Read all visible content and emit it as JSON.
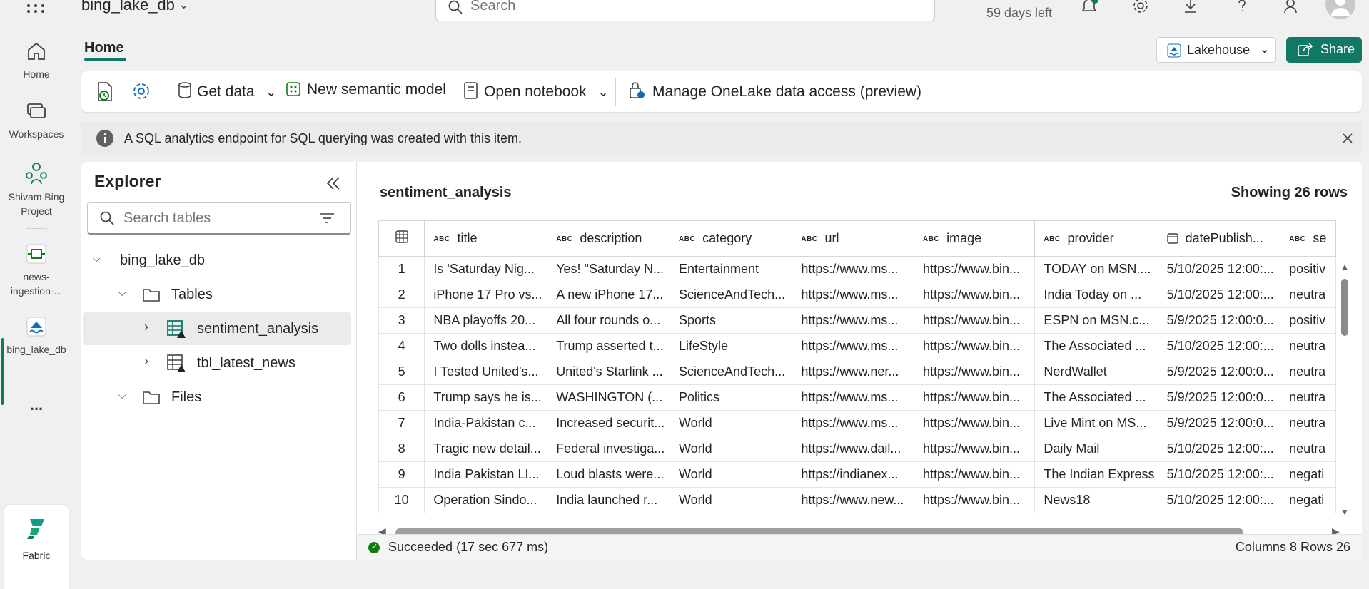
{
  "topbar": {
    "workspace_name": "bing_lake_db",
    "search_placeholder": "Search",
    "trial_text": "59 days left"
  },
  "rail": {
    "items": [
      {
        "label": "Home",
        "icon": "home-icon"
      },
      {
        "label": "Workspaces",
        "icon": "workspaces-icon"
      },
      {
        "label": "Shivam Bing Project",
        "icon": "workspace-people-icon"
      },
      {
        "label": "news-ingestion-...",
        "icon": "pipeline-icon"
      },
      {
        "label": "bing_lake_db",
        "icon": "lakehouse-icon"
      }
    ],
    "more": "...",
    "fabric_label": "Fabric"
  },
  "header": {
    "tab": "Home",
    "lakehouse_button": "Lakehouse",
    "share_button": "Share"
  },
  "ribbon": {
    "get_data": "Get data",
    "new_semantic_model": "New semantic model",
    "open_notebook": "Open notebook",
    "manage_access": "Manage OneLake data access (preview)"
  },
  "infobar": {
    "message": "A SQL analytics endpoint for SQL querying was created with this item."
  },
  "explorer": {
    "title": "Explorer",
    "search_placeholder": "Search tables",
    "db_name": "bing_lake_db",
    "tables_label": "Tables",
    "tables": [
      "sentiment_analysis",
      "tbl_latest_news"
    ],
    "files_label": "Files"
  },
  "grid": {
    "title": "sentiment_analysis",
    "row_count_label": "Showing 26 rows",
    "columns": [
      "title",
      "description",
      "category",
      "url",
      "image",
      "provider",
      "datePublish...",
      "se"
    ],
    "rows": [
      [
        "1",
        "Is 'Saturday Nig...",
        "Yes! \"Saturday N...",
        "Entertainment",
        "https://www.ms...",
        "https://www.bin...",
        "TODAY on MSN....",
        "5/10/2025 12:00:...",
        "positiv"
      ],
      [
        "2",
        "iPhone 17 Pro vs...",
        "A new iPhone 17...",
        "ScienceAndTech...",
        "https://www.ms...",
        "https://www.bin...",
        "India Today on ...",
        "5/10/2025 12:00:...",
        "neutra"
      ],
      [
        "3",
        "NBA playoffs 20...",
        "All four rounds o...",
        "Sports",
        "https://www.ms...",
        "https://www.bin...",
        "ESPN on MSN.c...",
        "5/9/2025 12:00:0...",
        "positiv"
      ],
      [
        "4",
        "Two dolls instea...",
        "Trump asserted t...",
        "LifeStyle",
        "https://www.ms...",
        "https://www.bin...",
        "The Associated ...",
        "5/10/2025 12:00:...",
        "neutra"
      ],
      [
        "5",
        "I Tested United's...",
        "United's Starlink ...",
        "ScienceAndTech...",
        "https://www.ner...",
        "https://www.bin...",
        "NerdWallet",
        "5/9/2025 12:00:0...",
        "neutra"
      ],
      [
        "6",
        "Trump says he is...",
        "WASHINGTON (...",
        "Politics",
        "https://www.ms...",
        "https://www.bin...",
        "The Associated ...",
        "5/9/2025 12:00:0...",
        "neutra"
      ],
      [
        "7",
        "India-Pakistan c...",
        "Increased securit...",
        "World",
        "https://www.ms...",
        "https://www.bin...",
        "Live Mint on MS...",
        "5/9/2025 12:00:0...",
        "neutra"
      ],
      [
        "8",
        "Tragic new detail...",
        "Federal investiga...",
        "World",
        "https://www.dail...",
        "https://www.bin...",
        "Daily Mail",
        "5/10/2025 12:00:...",
        "neutra"
      ],
      [
        "9",
        "India Pakistan LI...",
        "Loud blasts were...",
        "World",
        "https://indianex...",
        "https://www.bin...",
        "The Indian Express",
        "5/10/2025 12:00:...",
        "negati"
      ],
      [
        "10",
        "Operation Sindo...",
        "India launched r...",
        "World",
        "https://www.new...",
        "https://www.bin...",
        "News18",
        "5/10/2025 12:00:...",
        "negati"
      ]
    ]
  },
  "status": {
    "message": "Succeeded (17 sec 677 ms)",
    "summary": "Columns 8 Rows 26"
  },
  "colors": {
    "accent": "#117865",
    "success": "#107c10"
  }
}
